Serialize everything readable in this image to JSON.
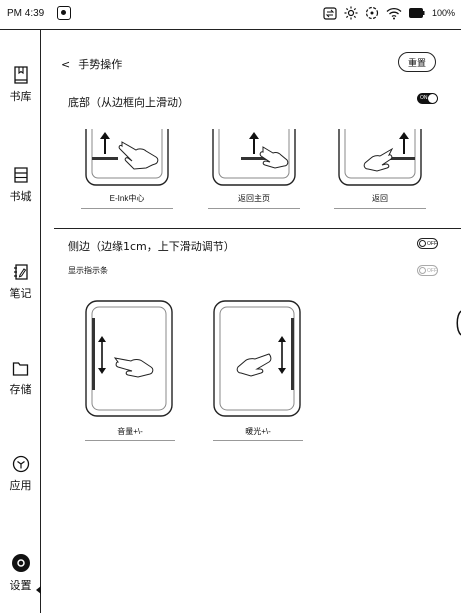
{
  "status_bar": {
    "time": "PM 4:39",
    "battery": "100%"
  },
  "sidebar": {
    "items": [
      {
        "label": "书库",
        "icon": "book-icon"
      },
      {
        "label": "书城",
        "icon": "store-icon"
      },
      {
        "label": "笔记",
        "icon": "note-icon"
      },
      {
        "label": "存储",
        "icon": "folder-icon"
      },
      {
        "label": "应用",
        "icon": "apps-icon"
      },
      {
        "label": "设置",
        "icon": "settings-icon",
        "active": true
      }
    ]
  },
  "header": {
    "back_symbol": "<",
    "title": "手势操作",
    "reset_label": "重置"
  },
  "bottom_section": {
    "title": "底部（从边框向上滑动）",
    "toggle_label": "ON",
    "toggle_state": "on",
    "gestures": [
      {
        "label": "E-Ink中心"
      },
      {
        "label": "返回主页"
      },
      {
        "label": "返回"
      }
    ]
  },
  "side_section": {
    "title": "侧边（边缘1cm，上下滑动调节）",
    "toggle_label": "OFF",
    "toggle_state": "off",
    "indicator_label": "显示指示条",
    "indicator_toggle_label": "OFF",
    "gestures": [
      {
        "label": "音量+\\-"
      },
      {
        "label": "暖光+\\-"
      }
    ]
  }
}
